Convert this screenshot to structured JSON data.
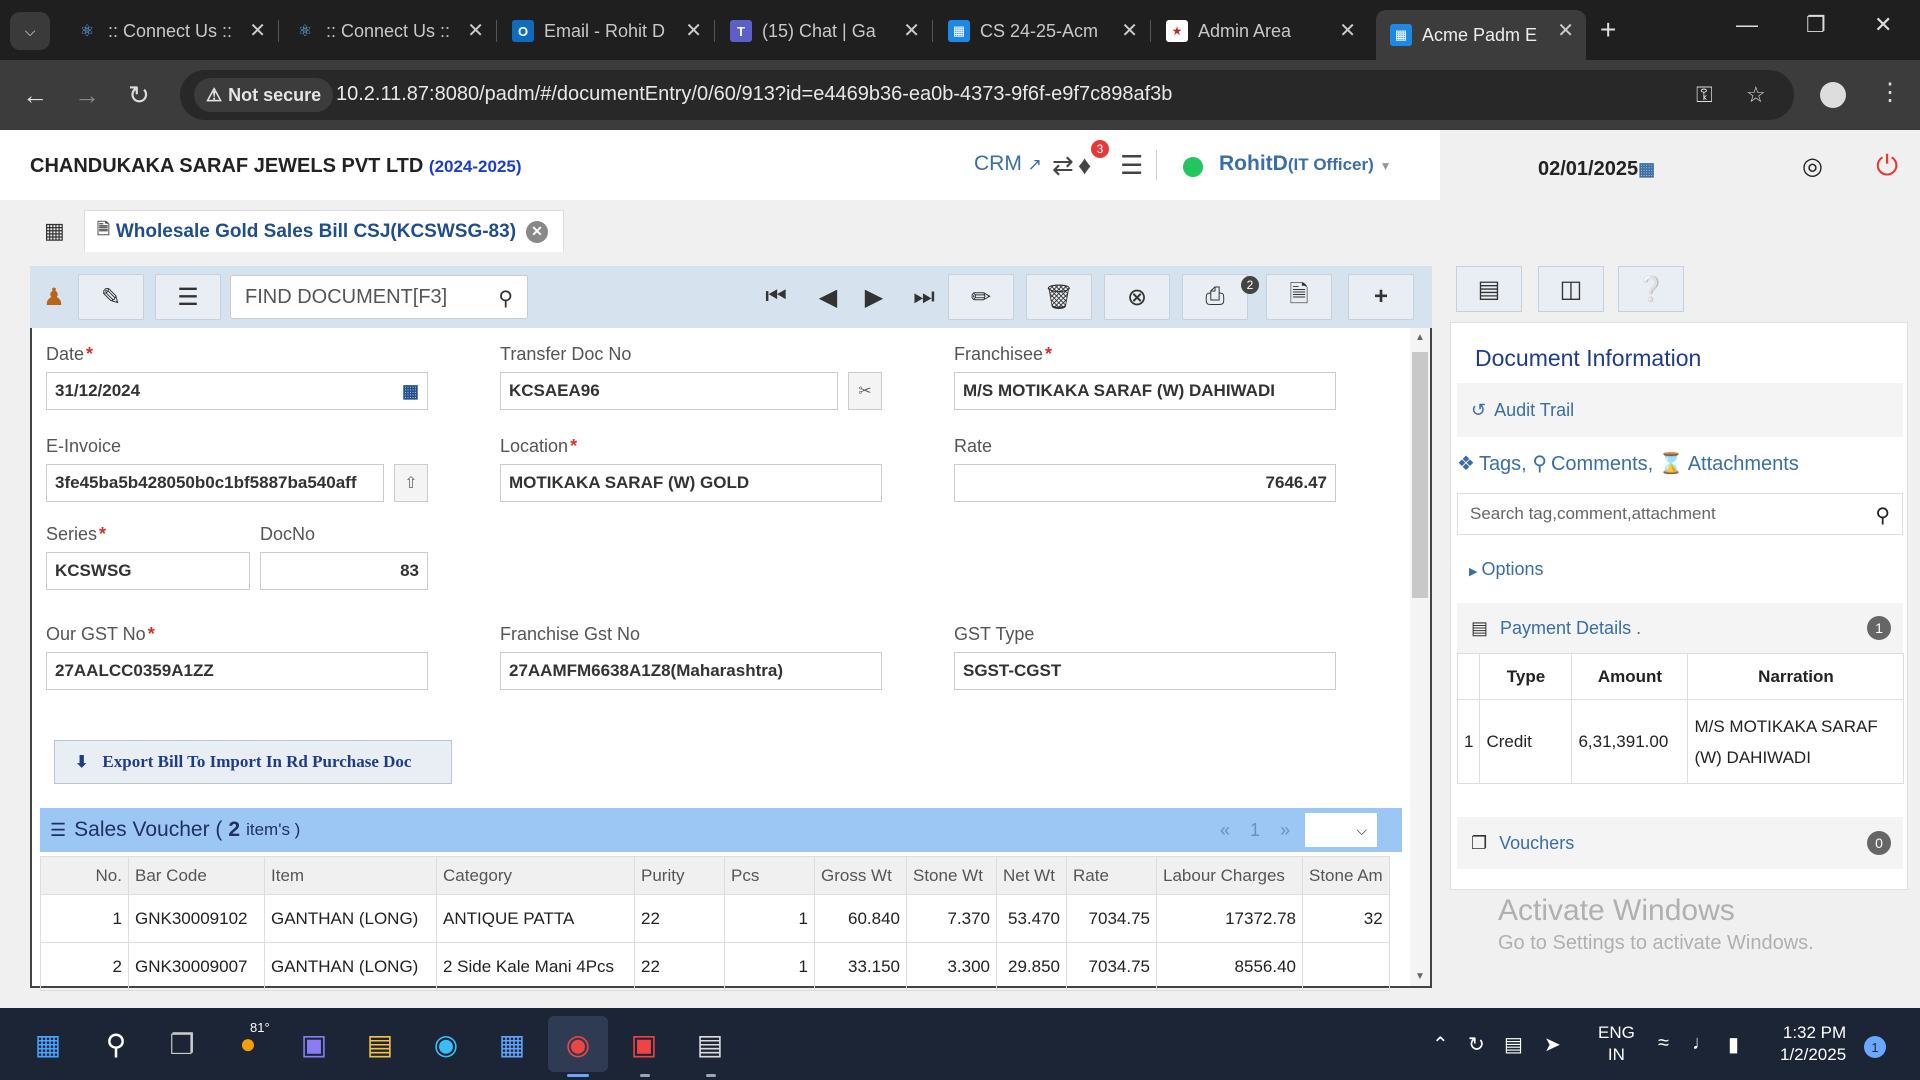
{
  "browser": {
    "tabs": [
      {
        "title": ":: Connect Us ::",
        "icon": "react-icon"
      },
      {
        "title": ":: Connect Us ::",
        "icon": "react-icon"
      },
      {
        "title": "Email - Rohit D",
        "icon": "outlook-icon"
      },
      {
        "title": "(15) Chat | Ga",
        "icon": "teams-icon"
      },
      {
        "title": "CS 24-25-Acm",
        "icon": "app-logo-icon"
      },
      {
        "title": "Admin Area",
        "icon": "admin-icon"
      },
      {
        "title": "Acme Padm E",
        "icon": "app-logo-icon"
      }
    ],
    "not_secure_label": "Not secure",
    "url": "10.2.11.87:8080/padm/#/documentEntry/0/60/913?id=e4469b36-ea0b-4373-9f6f-e9f7c898af3b"
  },
  "header": {
    "company": "CHANDUKAKA SARAF JEWELS PVT LTD",
    "year": "(2024-2025)",
    "crm_label": "CRM",
    "notification_count": "3",
    "user_name": "RohitD",
    "user_role": "(IT Officer)",
    "date": "02/01/2025"
  },
  "doc_tab": {
    "title": "Wholesale Gold Sales Bill CSJ(KCSWSG-83)"
  },
  "toolbar": {
    "find_placeholder": "FIND DOCUMENT[F3]",
    "print_badge": "2"
  },
  "form": {
    "date_label": "Date",
    "date_value": "31/12/2024",
    "transfer_label": "Transfer Doc No",
    "transfer_value": "KCSAEA96",
    "franchisee_label": "Franchisee",
    "franchisee_value": "M/S MOTIKAKA SARAF (W) DAHIWADI",
    "einvoice_label": "E-Invoice",
    "einvoice_value": "3fe45ba5b428050b0c1bf5887ba540aff",
    "location_label": "Location",
    "location_value": "MOTIKAKA SARAF (W) GOLD",
    "rate_label": "Rate",
    "rate_value": "7646.47",
    "series_label": "Series",
    "series_value": "KCSWSG",
    "docno_label": "DocNo",
    "docno_value": "83",
    "gst_label": "Our GST No",
    "gst_value": "27AALCC0359A1ZZ",
    "fgst_label": "Franchise Gst No",
    "fgst_value": "27AAMFM6638A1Z8(Maharashtra)",
    "gsttype_label": "GST Type",
    "gsttype_value": "SGST-CGST",
    "export_label": "Export Bill To Import In Rd Purchase Doc"
  },
  "sales_voucher": {
    "title": "Sales Voucher (",
    "count": "2",
    "items_label": "item's )",
    "page": "1",
    "columns": [
      "No.",
      "Bar Code",
      "Item",
      "Category",
      "Purity",
      "Pcs",
      "Gross Wt",
      "Stone Wt",
      "Net Wt",
      "Rate",
      "Labour Charges",
      "Stone Am"
    ],
    "rows": [
      [
        "1",
        "GNK30009102",
        "GANTHAN (LONG)",
        "ANTIQUE PATTA",
        "22",
        "1",
        "60.840",
        "7.370",
        "53.470",
        "7034.75",
        "17372.78",
        "32"
      ],
      [
        "2",
        "GNK30009007",
        "GANTHAN (LONG)",
        "2 Side Kale Mani 4Pcs",
        "22",
        "1",
        "33.150",
        "3.300",
        "29.850",
        "7034.75",
        "8556.40",
        ""
      ]
    ]
  },
  "right_panel": {
    "title": "Document Information",
    "audit_trail": "Audit Trail",
    "tags": "Tags,",
    "comments": "Comments,",
    "attachments": "Attachments",
    "search_placeholder": "Search tag,comment,attachment",
    "options": "Options",
    "payment_details": "Payment Details .",
    "payment_count": "1",
    "payment_columns": [
      "",
      "Type",
      "Amount",
      "Narration"
    ],
    "payment_rows": [
      [
        "1",
        "Credit",
        "6,31,391.00",
        "M/S MOTIKAKA SARAF (W) DAHIWADI"
      ]
    ],
    "vouchers": "Vouchers",
    "vouchers_count": "0"
  },
  "watermark": {
    "line1": "Activate Windows",
    "line2": "Go to Settings to activate Windows."
  },
  "taskbar": {
    "temperature": "81°",
    "lang1": "ENG",
    "lang2": "IN",
    "time": "1:32 PM",
    "date": "1/2/2025",
    "notif": "1"
  }
}
